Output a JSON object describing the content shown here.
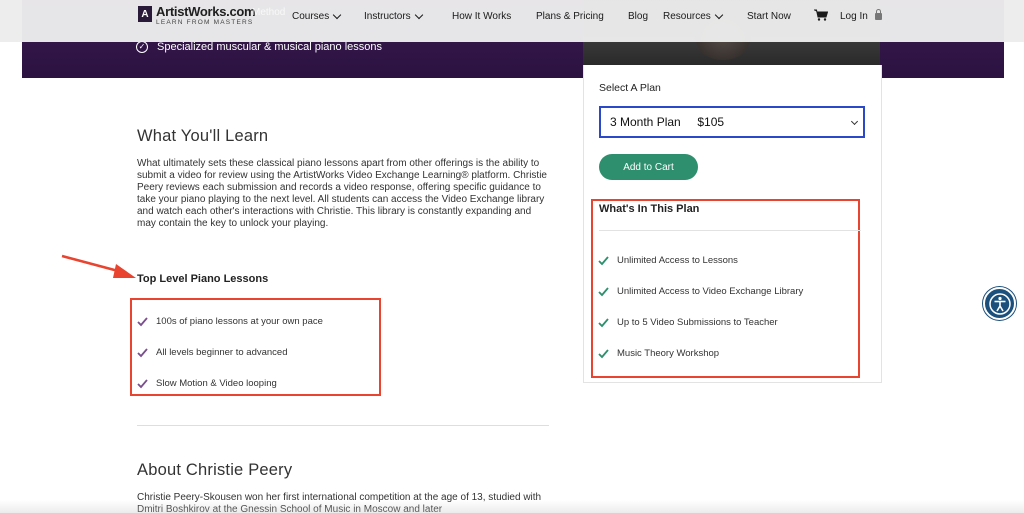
{
  "nav": {
    "logo_name": "ArtistWorks.com",
    "logo_tagline": "LEARN FROM MASTERS",
    "logo_mark": "A",
    "ghost_text": "Method",
    "items": [
      {
        "label": "Courses",
        "dropdown": true
      },
      {
        "label": "Instructors",
        "dropdown": true
      },
      {
        "label": "How It Works",
        "dropdown": false
      },
      {
        "label": "Plans & Pricing",
        "dropdown": false
      },
      {
        "label": "Blog",
        "dropdown": false
      },
      {
        "label": "Resources",
        "dropdown": true
      },
      {
        "label": "Start Now",
        "dropdown": false
      }
    ],
    "login_label": "Log In",
    "cart_icon": "cart-icon",
    "lock_icon": "lock-icon"
  },
  "hero": {
    "bullet": "Specialized muscular & musical piano lessons",
    "icon": "check-circle-icon"
  },
  "main": {
    "learn_title": "What You'll Learn",
    "learn_paragraph": "What ultimately sets these classical piano lessons apart from other offerings is the ability to submit a video for review using the ArtistWorks Video Exchange Learning® platform. Christie Peery reviews each submission and records a video response, offering specific guidance to take your piano playing to the next level. All students can access the Video Exchange library and watch each other's interactions with Christie. This library is constantly expanding and may contain the key to unlock your playing.",
    "top_level_title": "Top Level Piano Lessons",
    "top_level_items": [
      "100s of piano lessons at your own pace",
      "All levels beginner to advanced",
      "Slow Motion & Video looping"
    ],
    "about_title": "About Christie Peery",
    "about_paragraph": "Christie Peery-Skousen won her first international competition at the age of 13, studied with Dmitri Boshkirov at the Gnessin School of Music in Moscow and later"
  },
  "sidebar": {
    "select_label": "Select A Plan",
    "select_value": "3 Month Plan     $105",
    "add_to_cart": "Add to Cart",
    "plan_title": "What's In This Plan",
    "plan_items": [
      "Unlimited Access to Lessons",
      "Unlimited Access to Video Exchange Library",
      "Up to 5 Video Submissions to Teacher",
      "Music Theory Workshop"
    ]
  },
  "colors": {
    "hero_purple": "#2b1240",
    "check_purple": "#7a4f8c",
    "check_green": "#2e8f6f",
    "button_green": "#2e8f6f",
    "select_border": "#2b48c9",
    "annotation_red": "#e8442f",
    "a11y_blue": "#1b4f7c"
  },
  "accessibility": {
    "icon": "accessibility-icon"
  }
}
